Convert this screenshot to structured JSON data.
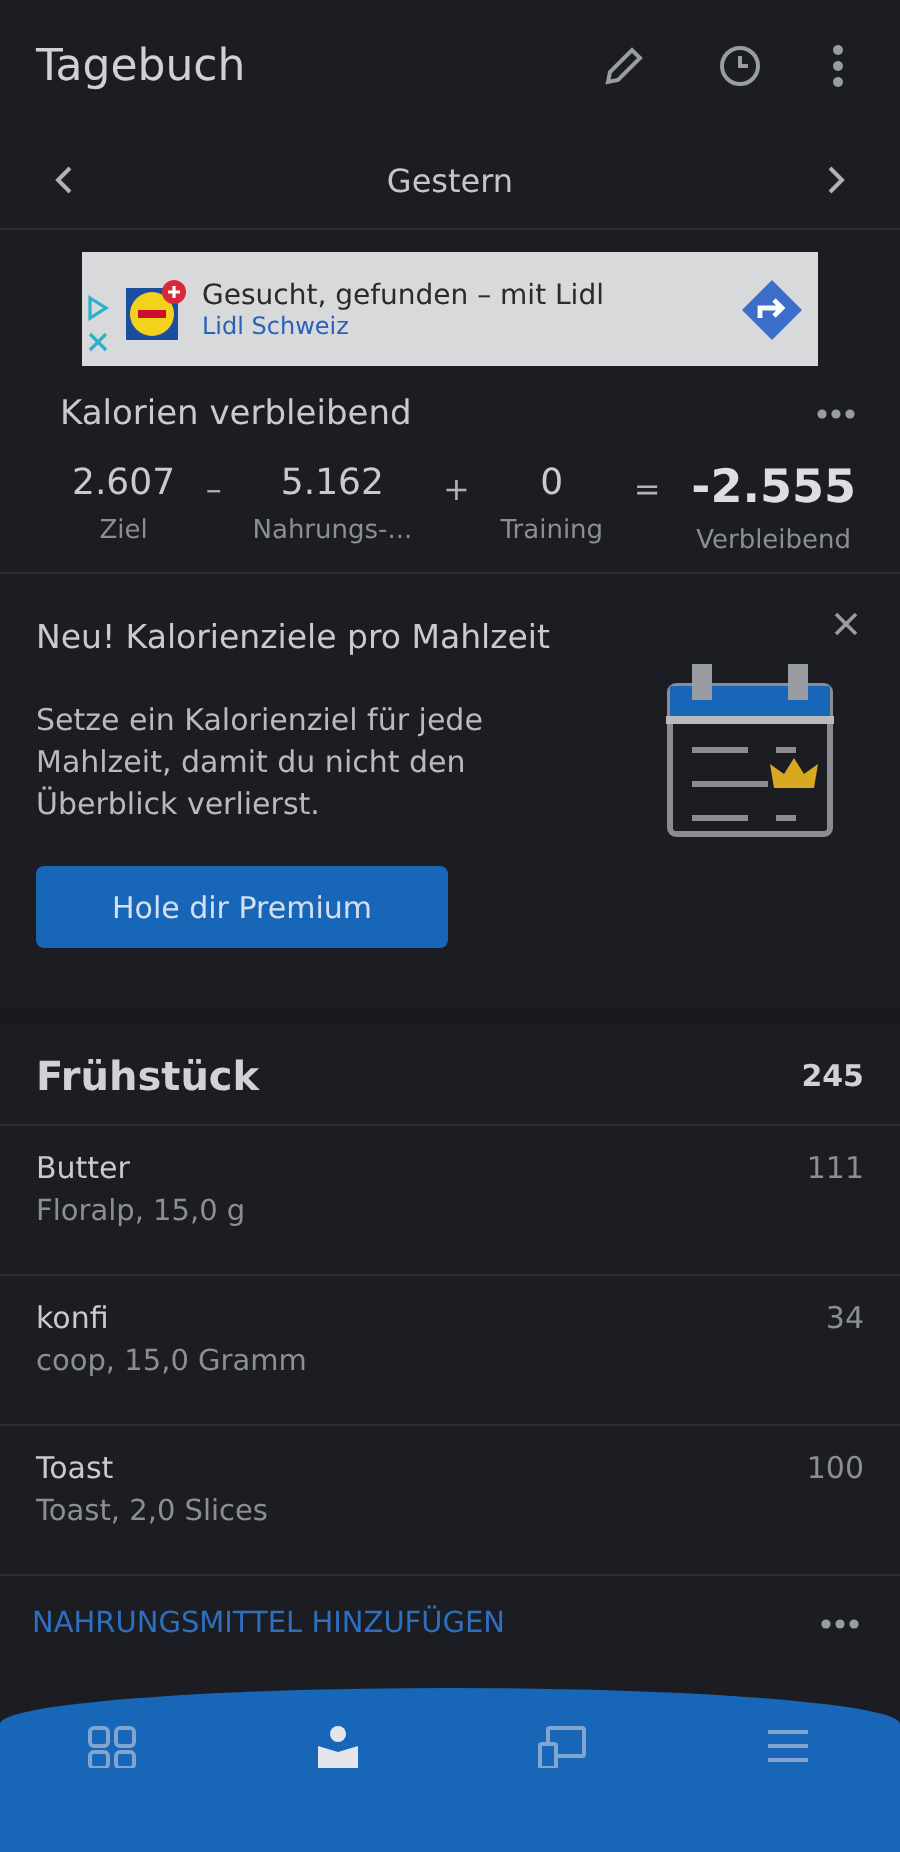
{
  "header": {
    "title": "Tagebuch"
  },
  "date_nav": {
    "label": "Gestern"
  },
  "ad": {
    "headline": "Gesucht, gefunden – mit Lidl",
    "advertiser": "Lidl Schweiz"
  },
  "calories": {
    "title": "Kalorien verbleibend",
    "terms": [
      {
        "kind": "term",
        "value": "2.607",
        "label": "Ziel"
      },
      {
        "kind": "term",
        "operator": "–",
        "value": "5.162",
        "label": "Nahrungs-..."
      },
      {
        "kind": "term",
        "operator": "+",
        "value": "0",
        "label": "Training"
      },
      {
        "kind": "result",
        "operator": "=",
        "value": "-2.555",
        "label": "Verbleibend"
      }
    ]
  },
  "promo": {
    "title": "Neu! Kalorienziele pro Mahlzeit",
    "body": "Setze ein Kalorienziel für jede Mahlzeit, damit du nicht den Überblick verlierst.",
    "button": "Hole dir Premium"
  },
  "meal": {
    "name": "Frühstück",
    "total": "245",
    "entries": [
      {
        "name": "Butter",
        "detail": "Floralp, 15,0 g",
        "calories": "111"
      },
      {
        "name": "konfi",
        "detail": "coop, 15,0 Gramm",
        "calories": "34"
      },
      {
        "name": "Toast",
        "detail": "Toast, 2,0 Slices",
        "calories": "100"
      }
    ],
    "add_label": "NAHRUNGSMITTEL HINZUFÜGEN"
  },
  "bottom_nav": {
    "tabs": [
      {
        "kind": "dashboard",
        "selected": false
      },
      {
        "kind": "diary",
        "selected": true
      },
      {
        "kind": "plans",
        "selected": false
      },
      {
        "kind": "more",
        "selected": false
      }
    ]
  }
}
